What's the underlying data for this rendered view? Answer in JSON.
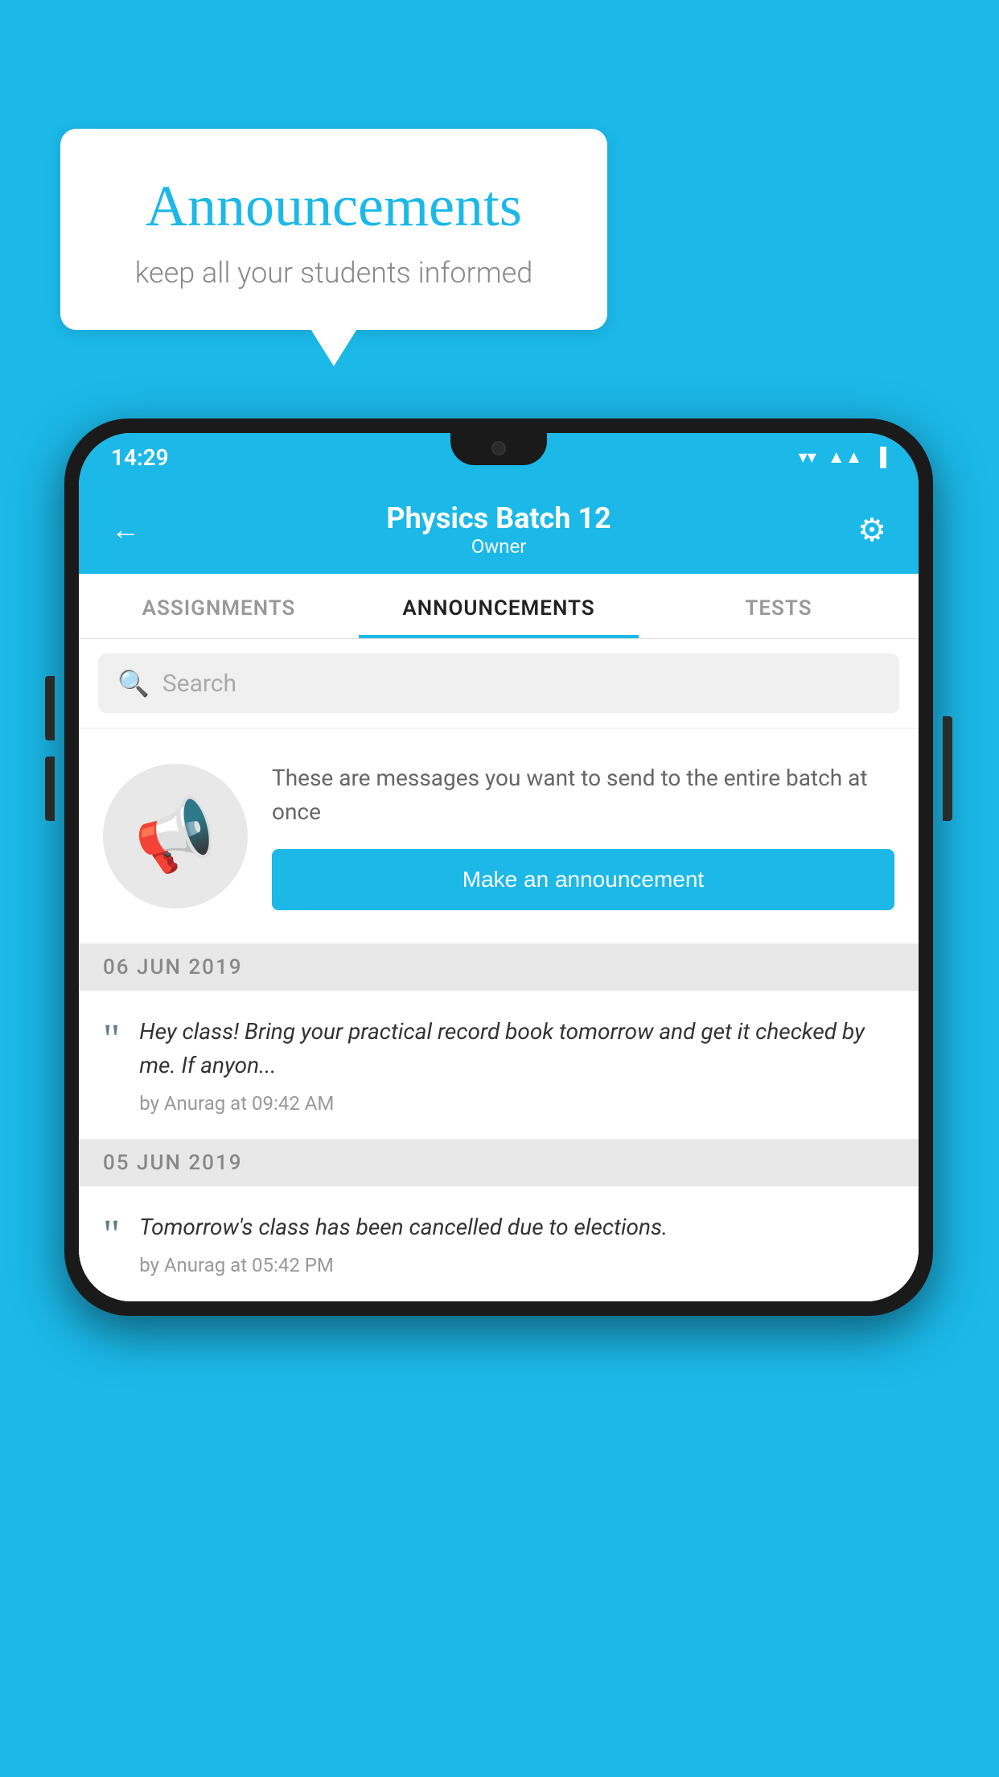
{
  "bubble": {
    "title": "Announcements",
    "subtitle": "keep all your students informed"
  },
  "status_bar": {
    "time": "14:29",
    "wifi": "▼",
    "signal": "▲",
    "battery": "▌"
  },
  "header": {
    "title": "Physics Batch 12",
    "subtitle": "Owner",
    "back_label": "←",
    "gear_label": "⚙"
  },
  "tabs": [
    {
      "label": "ASSIGNMENTS",
      "active": false
    },
    {
      "label": "ANNOUNCEMENTS",
      "active": true
    },
    {
      "label": "TESTS",
      "active": false
    }
  ],
  "search": {
    "placeholder": "Search"
  },
  "promo": {
    "text": "These are messages you want to send to the entire batch at once",
    "button_label": "Make an announcement"
  },
  "announcements": [
    {
      "date": "06  JUN  2019",
      "text": "Hey class! Bring your practical record book tomorrow and get it checked by me. If anyon...",
      "meta": "by Anurag at 09:42 AM"
    },
    {
      "date": "05  JUN  2019",
      "text": "Tomorrow's class has been cancelled due to elections.",
      "meta": "by Anurag at 05:42 PM"
    }
  ]
}
